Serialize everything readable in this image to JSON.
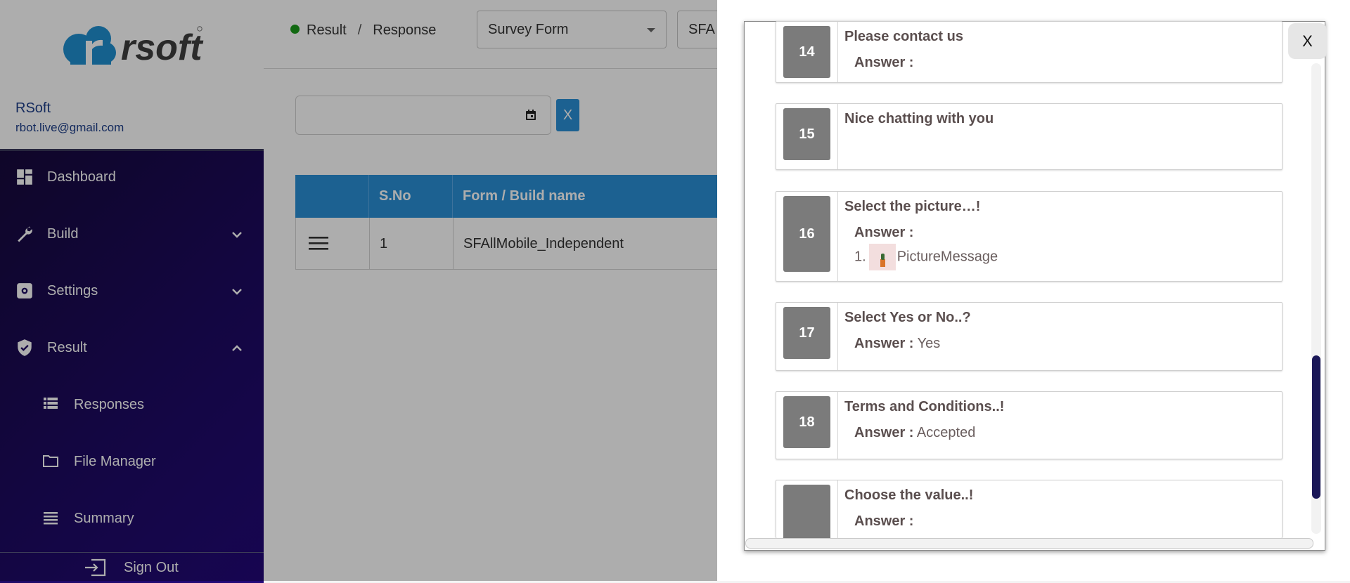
{
  "brand": {
    "name": "rsoft"
  },
  "user": {
    "name": "RSoft",
    "email": "rbot.live@gmail.com"
  },
  "sidebar": {
    "items": [
      {
        "label": "Dashboard",
        "icon": "dashboard-icon"
      },
      {
        "label": "Build",
        "icon": "wrench-icon"
      },
      {
        "label": "Settings",
        "icon": "gear-icon"
      },
      {
        "label": "Result",
        "icon": "shield-icon"
      }
    ],
    "sub_items": [
      {
        "label": "Responses",
        "icon": "list-icon"
      },
      {
        "label": "File Manager",
        "icon": "folder-icon"
      },
      {
        "label": "Summary",
        "icon": "summary-icon"
      }
    ],
    "signout": "Sign Out"
  },
  "breadcrumb": {
    "first": "Result",
    "separator": "/",
    "second": "Response"
  },
  "filters": {
    "form_type": "Survey Form",
    "build": "SFA"
  },
  "clear_label": "X",
  "table": {
    "headers": [
      "",
      "S.No",
      "Form / Build name"
    ],
    "rows": [
      {
        "sno": "1",
        "name": "SFAllMobile_Independent"
      }
    ]
  },
  "modal": {
    "close_label": "X",
    "questions": [
      {
        "num": "14",
        "title": "Please contact us",
        "answer_label": "Answer :",
        "answer": ""
      },
      {
        "num": "15",
        "title": "Nice chatting with you"
      },
      {
        "num": "16",
        "title": "Select the picture…!",
        "answer_label": "Answer :",
        "item_index": "1.",
        "item_text": "PictureMessage"
      },
      {
        "num": "17",
        "title": "Select Yes or No..?",
        "answer_label": "Answer :",
        "answer": "Yes"
      },
      {
        "num": "18",
        "title": "Terms and Conditions..!",
        "answer_label": "Answer :",
        "answer": "Accepted"
      },
      {
        "num": "",
        "title": "Choose the value..!",
        "answer_label": "Answer :",
        "answer": ""
      }
    ]
  },
  "colors": {
    "accent": "#2a8fd6",
    "nav_dark": "#1d0a62",
    "number_box": "#7b7b7b",
    "status_dot": "#1b9b1b"
  }
}
